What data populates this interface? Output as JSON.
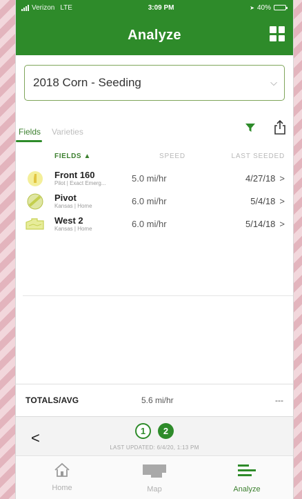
{
  "status_bar": {
    "carrier": "Verizon",
    "network": "LTE",
    "time": "3:09 PM",
    "battery": "40%",
    "battery_level": 0.4
  },
  "header": {
    "title": "Analyze",
    "grid_icon": "grid-icon"
  },
  "selector": {
    "value": "2018 Corn - Seeding"
  },
  "tabs": [
    {
      "label": "Fields",
      "active": true
    },
    {
      "label": "Varieties",
      "active": false
    }
  ],
  "tools": {
    "filter_icon": "filter-icon",
    "share_icon": "share-icon"
  },
  "table": {
    "headers": {
      "fields": "FIELDS ▲",
      "speed": "SPEED",
      "last_seeded": "LAST SEEDED"
    },
    "rows": [
      {
        "name": "Front 160",
        "sub": "Pilot | Exact Emerg...",
        "speed": "5.0 mi/hr",
        "last_seeded": "4/27/18",
        "arrow": ">",
        "icon": "field-shape-icon",
        "color": "#e2c542"
      },
      {
        "name": "Pivot",
        "sub": "Kansas | Home",
        "speed": "6.0 mi/hr",
        "last_seeded": "5/4/18",
        "arrow": ">",
        "icon": "pivot-circle-icon",
        "color": "#c4cf4e"
      },
      {
        "name": "West 2",
        "sub": "Kansas | Home",
        "speed": "6.0 mi/hr",
        "last_seeded": "5/14/18",
        "arrow": ">",
        "icon": "field-shape-icon",
        "color": "#c7d155"
      }
    ]
  },
  "totals": {
    "label": "TOTALS/AVG",
    "speed": "5.6 mi/hr",
    "last": "---"
  },
  "pager": {
    "back": "<",
    "pages": [
      "1",
      "2"
    ],
    "current_page": 2,
    "updated": "LAST UPDATED: 6/4/20, 1:13 PM"
  },
  "tab_bar": [
    {
      "label": "Home",
      "icon": "home-icon",
      "active": false
    },
    {
      "label": "Map",
      "icon": "map-icon",
      "active": false
    },
    {
      "label": "Analyze",
      "icon": "analyze-icon",
      "active": true
    }
  ],
  "colors": {
    "brand_green": "#2e8b2a",
    "accent_green": "#3b7f2e"
  }
}
